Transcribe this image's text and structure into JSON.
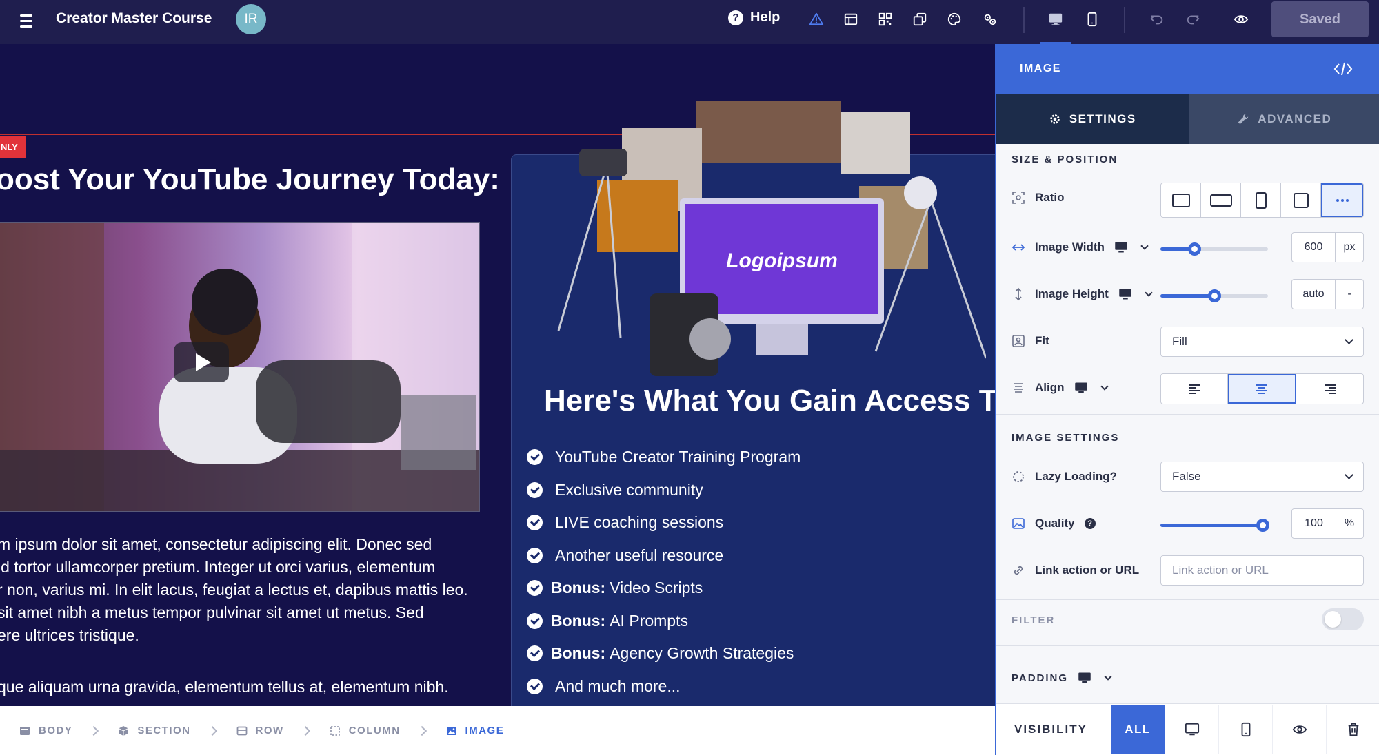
{
  "topbar": {
    "title": "Creator Master Course",
    "avatar_initials": "IR",
    "help_label": "Help",
    "saved_label": "Saved",
    "icons": [
      "menu-icon",
      "help-icon",
      "warning-icon",
      "layout-icon",
      "qr-icon",
      "layers-icon",
      "palette-icon",
      "settings-gears-icon",
      "desktop-icon",
      "mobile-icon",
      "undo-icon",
      "redo-icon",
      "preview-eye-icon"
    ],
    "accent": "#3b68d7"
  },
  "canvas": {
    "only_badge": "NLY",
    "left_heading": "oost Your YouTube Journey Today:",
    "body_lines": [
      "m ipsum dolor sit amet, consectetur adipiscing elit. Donec sed",
      " id tortor ullamcorper pretium. Integer ut orci varius, elementum",
      "r non, varius mi. In elit lacus, feugiat a lectus et, dapibus mattis leo.",
      " sit amet nibh a metus tempor pulvinar sit amet ut metus. Sed",
      "ere ultrices tristique."
    ],
    "body_line2": "que aliquam urna gravida, elementum tellus at, elementum nibh.",
    "logo_text": "Logoipsum",
    "gain_heading": "Here's What You Gain Access To:",
    "gain_items": [
      {
        "bold": "",
        "text": "YouTube Creator Training Program"
      },
      {
        "bold": "",
        "text": "Exclusive community"
      },
      {
        "bold": "",
        "text": "LIVE coaching sessions"
      },
      {
        "bold": "",
        "text": "Another useful resource"
      },
      {
        "bold": "Bonus:",
        "text": "Video Scripts"
      },
      {
        "bold": "Bonus:",
        "text": "AI Prompts"
      },
      {
        "bold": "Bonus:",
        "text": "Agency Growth Strategies"
      },
      {
        "bold": "",
        "text": "And much more..."
      }
    ]
  },
  "breadcrumb": [
    {
      "label": "BODY",
      "icon": "body-icon",
      "active": false
    },
    {
      "label": "SECTION",
      "icon": "section-cube-icon",
      "active": false
    },
    {
      "label": "ROW",
      "icon": "row-icon",
      "active": false
    },
    {
      "label": "COLUMN",
      "icon": "column-dashed-icon",
      "active": false
    },
    {
      "label": "IMAGE",
      "icon": "image-icon",
      "active": true
    }
  ],
  "panel": {
    "title": "IMAGE",
    "tabs": {
      "settings": "SETTINGS",
      "advanced": "ADVANCED"
    },
    "size_position": {
      "title": "SIZE & POSITION",
      "ratio_label": "Ratio",
      "ratio_options": [
        "square",
        "landscape-wide",
        "portrait",
        "square-small",
        "custom"
      ],
      "ratio_selected": "custom",
      "width_label": "Image Width",
      "width_value": "600",
      "width_unit": "px",
      "width_slider_percent": 32,
      "height_label": "Image Height",
      "height_value": "auto",
      "height_unit": "-",
      "height_slider_percent": 50,
      "fit_label": "Fit",
      "fit_value": "Fill",
      "align_label": "Align",
      "align_selected": "center"
    },
    "image_settings": {
      "title": "IMAGE SETTINGS",
      "lazy_label": "Lazy Loading?",
      "lazy_value": "False",
      "quality_label": "Quality",
      "quality_value": "100",
      "quality_unit": "%",
      "quality_slider_percent": 100,
      "link_label": "Link action or URL",
      "link_placeholder": "Link action or URL"
    },
    "filter_label": "FILTER",
    "filter_on": false,
    "padding_label": "PADDING",
    "visibility": {
      "label": "VISIBILITY",
      "all": "ALL"
    }
  }
}
